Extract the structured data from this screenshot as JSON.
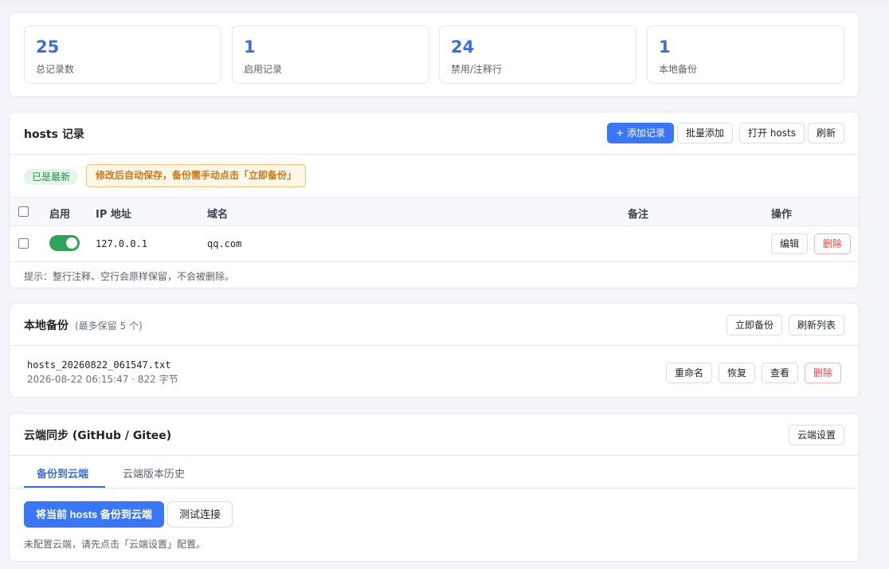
{
  "stats": [
    {
      "value": "25",
      "label": "总记录数"
    },
    {
      "value": "1",
      "label": "启用记录"
    },
    {
      "value": "24",
      "label": "禁用/注释行"
    },
    {
      "value": "1",
      "label": "本地备份"
    }
  ],
  "hosts": {
    "title": "hosts 记录",
    "add_label": "+ 添加记录",
    "batch_label": "批量添加",
    "open_label": "打开 hosts",
    "refresh_label": "刷新",
    "status_badge": "已是最新",
    "notice": "修改后自动保存，备份需手动点击「立即备份」",
    "columns": {
      "enabled": "启用",
      "ip": "IP 地址",
      "domain": "域名",
      "note": "备注",
      "actions": "操作"
    },
    "rows": [
      {
        "enabled": true,
        "ip": "127.0.0.1",
        "domain": "qq.com",
        "note": "",
        "edit_label": "编辑",
        "delete_label": "删除"
      }
    ],
    "hint": "提示：整行注释、空行会原样保留，不会被删除。"
  },
  "backup": {
    "title": "本地备份",
    "subtitle": "(最多保留 5 个)",
    "backup_now_label": "立即备份",
    "refresh_list_label": "刷新列表",
    "items": [
      {
        "name": "hosts_20260822_061547.txt",
        "meta": "2026-08-22 06:15:47 · 822 字节",
        "rename_label": "重命名",
        "restore_label": "恢复",
        "view_label": "查看",
        "delete_label": "删除"
      }
    ]
  },
  "cloud": {
    "title": "云端同步 (GitHub / Gitee)",
    "settings_label": "云端设置",
    "tabs": [
      {
        "label": "备份到云端",
        "active": true
      },
      {
        "label": "云端版本历史",
        "active": false
      }
    ],
    "backup_btn_label": "将当前 hosts 备份到云端",
    "test_btn_label": "测试连接",
    "hint": "未配置云端，请先点击「云端设置」配置。"
  },
  "colors": {
    "accent": "#3b76f6",
    "stat_number": "#3d6fd8",
    "toggle_on": "#2fa25c",
    "danger": "#e0464f",
    "warning": "#c7791c"
  }
}
